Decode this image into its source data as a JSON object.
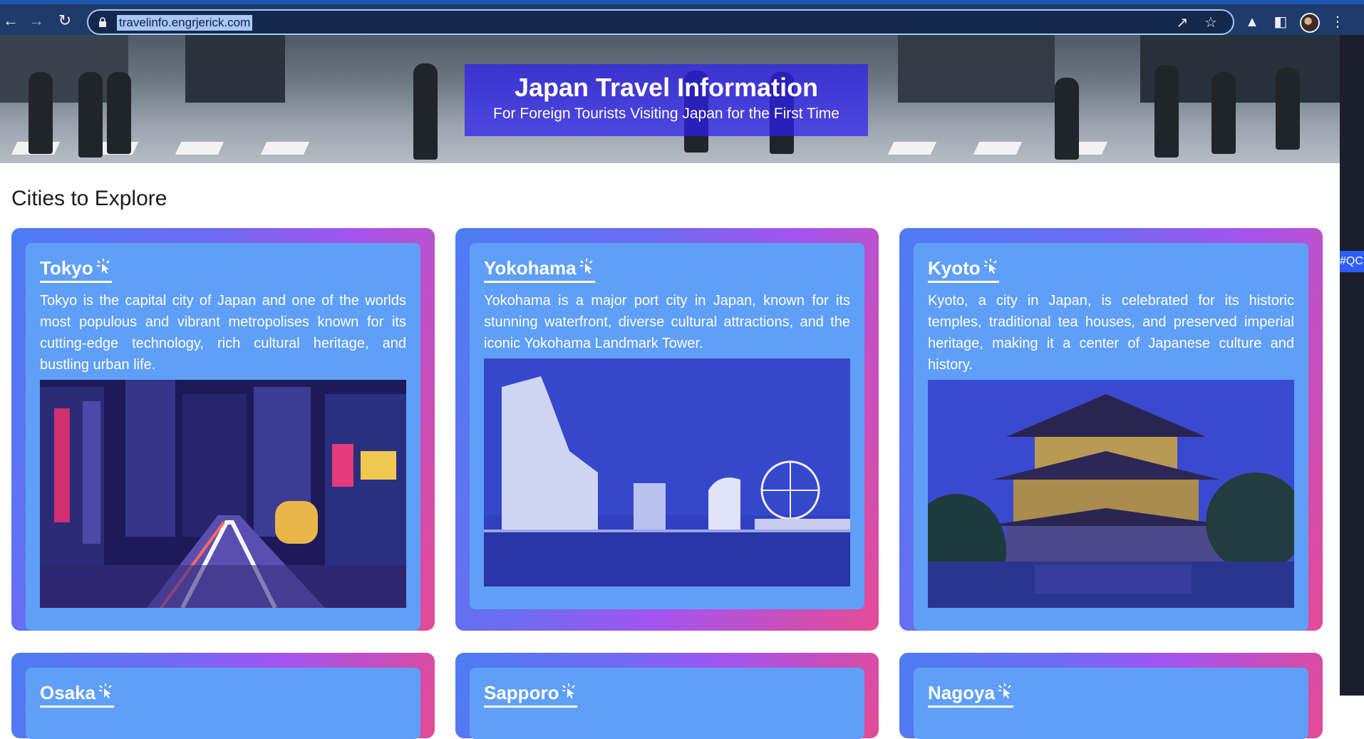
{
  "browser": {
    "url": "travelinfo.engrjerick.com",
    "icons": [
      "back-icon",
      "forward-icon",
      "reload-icon",
      "lock-icon",
      "share-icon",
      "star-icon",
      "extensions-icon",
      "side-panel-icon",
      "menu-icon"
    ]
  },
  "hero": {
    "title": "Japan Travel Information",
    "subtitle": "For Foreign Tourists Visiting Japan for the First Time"
  },
  "section": {
    "title": "Cities to Explore"
  },
  "cities": [
    {
      "name": "Tokyo",
      "description": "Tokyo is the capital city of Japan and one of the worlds most populous and vibrant metropolises known for its cutting-edge technology, rich cultural heritage, and bustling urban life."
    },
    {
      "name": "Yokohama",
      "description": "Yokohama is a major port city in Japan, known for its stunning waterfront, diverse cultural attractions, and the iconic Yokohama Landmark Tower."
    },
    {
      "name": "Kyoto",
      "description": "Kyoto, a city in Japan, is celebrated for its historic temples, traditional tea houses, and preserved imperial heritage, making it a center of Japanese culture and history."
    },
    {
      "name": "Osaka",
      "description": ""
    },
    {
      "name": "Sapporo",
      "description": ""
    },
    {
      "name": "Nagoya",
      "description": ""
    }
  ],
  "side_tag": "#QC",
  "colors": {
    "hero_box": "#2d1ef0",
    "card_gradient_start": "#4d7cf3",
    "card_gradient_end": "#e44b95",
    "card_inner": "#5f9ff7"
  }
}
